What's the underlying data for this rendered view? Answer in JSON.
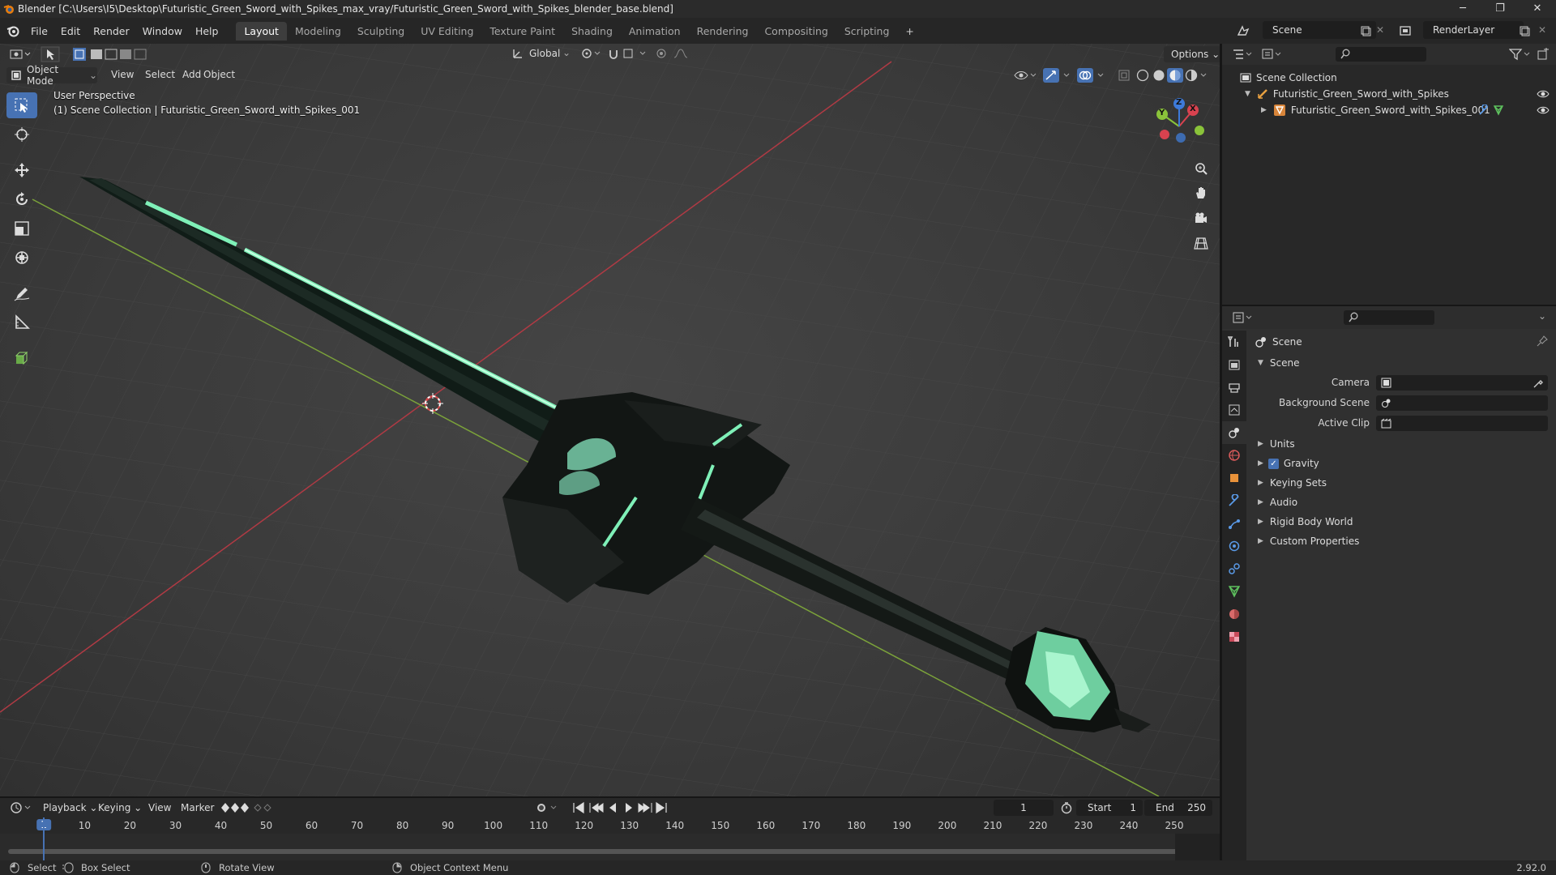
{
  "window": {
    "title": "Blender [C:\\Users\\I5\\Desktop\\Futuristic_Green_Sword_with_Spikes_max_vray/Futuristic_Green_Sword_with_Spikes_blender_base.blend]",
    "minimize": "─",
    "maximize": "❐",
    "close": "✕"
  },
  "menu": [
    "File",
    "Edit",
    "Render",
    "Window",
    "Help"
  ],
  "workspaces": [
    "Layout",
    "Modeling",
    "Sculpting",
    "UV Editing",
    "Texture Paint",
    "Shading",
    "Animation",
    "Rendering",
    "Compositing",
    "Scripting"
  ],
  "active_workspace": "Layout",
  "add_workspace": "+",
  "scene_name": "Scene",
  "view_layer": "RenderLayer",
  "viewport": {
    "transform_orientation": "Global",
    "options_label": "Options",
    "mode": "Object Mode",
    "header_menus": [
      "View",
      "Select",
      "Add",
      "Object"
    ],
    "perspective": "User Perspective",
    "collection_info": "(1) Scene Collection | Futuristic_Green_Sword_with_Spikes_001",
    "axes": {
      "x": "X",
      "y": "Y",
      "z": "Z"
    }
  },
  "tools": [
    "select-box-icon",
    "cursor-icon",
    "move-icon",
    "rotate-icon",
    "scale-icon",
    "transform-icon",
    "annotate-icon",
    "measure-icon",
    "add-cube-icon"
  ],
  "outliner": {
    "root": "Scene Collection",
    "collection": "Futuristic_Green_Sword_with_Spikes",
    "object": "Futuristic_Green_Sword_with_Spikes_001"
  },
  "properties": {
    "context": "Scene",
    "panel": "Scene",
    "fields": [
      {
        "label": "Camera",
        "value": ""
      },
      {
        "label": "Background Scene",
        "value": ""
      },
      {
        "label": "Active Clip",
        "value": ""
      }
    ],
    "subpanels": [
      "Units",
      "Gravity",
      "Keying Sets",
      "Audio",
      "Rigid Body World",
      "Custom Properties"
    ],
    "gravity_checked": true
  },
  "timeline": {
    "menus": [
      "Playback",
      "Keying",
      "View",
      "Marker"
    ],
    "current_frame": "1",
    "start_label": "Start",
    "start": "1",
    "end_label": "End",
    "end": "250",
    "ticks": [
      "1",
      "10",
      "20",
      "30",
      "40",
      "50",
      "60",
      "70",
      "80",
      "90",
      "100",
      "110",
      "120",
      "130",
      "140",
      "150",
      "160",
      "170",
      "180",
      "190",
      "200",
      "210",
      "220",
      "230",
      "240",
      "250"
    ]
  },
  "statusbar": {
    "select": "Select",
    "box_select": "Box Select",
    "rotate_view": "Rotate View",
    "context_menu": "Object Context Menu",
    "version": "2.92.0"
  },
  "colors": {
    "accent": "#4772b3",
    "x_axis": "#d8424f",
    "y_axis": "#8ac33a",
    "z_axis": "#3d7ad9",
    "sword_glow": "#7ff0b8"
  }
}
